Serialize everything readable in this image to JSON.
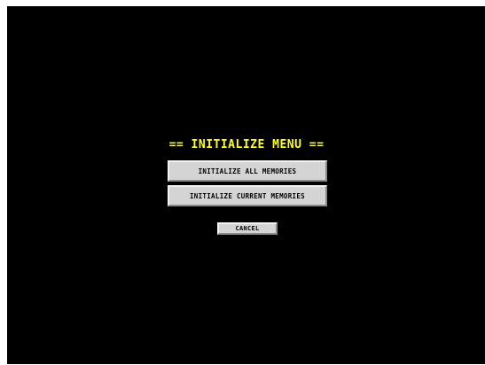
{
  "menu": {
    "title": "== INITIALIZE MENU ==",
    "buttons": {
      "initialize_all": "INITIALIZE ALL MEMORIES",
      "initialize_current": "INITIALIZE CURRENT MEMORIES",
      "cancel": "CANCEL"
    }
  },
  "colors": {
    "background": "#000000",
    "title": "#ffff1a",
    "button_face": "#d4d4d4"
  }
}
